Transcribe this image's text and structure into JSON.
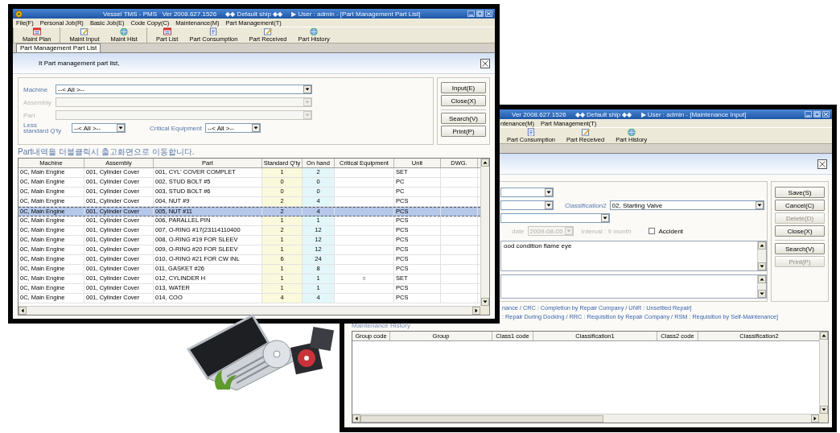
{
  "part_list_window": {
    "title": "Vessel TMS - PMS   Ver 2008.627.1526     ◆◆ Default ship ◆◆     ▶ User : admin - [Part Management Part List]",
    "menu": [
      "File(F)",
      "Personal Job(R)",
      "Basic Job(E)",
      "Code Copy(C)",
      "Maintenance(M)",
      "Part Management(T)"
    ],
    "toolbar": [
      [
        {
          "label": "Maint Plan",
          "kind": "calendar"
        }
      ],
      [
        {
          "label": "Maint Input",
          "kind": "notepad"
        },
        {
          "label": "Maint Hist",
          "kind": "globe"
        }
      ],
      [
        {
          "label": "Part List",
          "kind": "calendar"
        },
        {
          "label": "Part Consumption",
          "kind": "document"
        },
        {
          "label": "Part Received",
          "kind": "notepad"
        },
        {
          "label": "Part History",
          "kind": "globe"
        }
      ]
    ],
    "tab": "Part Management Part List",
    "header": "It Part management part list,",
    "filters": [
      {
        "label": "Machine",
        "value": "--< All >--",
        "disabled": false
      },
      {
        "label": "Assembly",
        "disabled": true
      },
      {
        "label": "Part",
        "disabled": true
      }
    ],
    "less_standard_qty": {
      "label": "Less standard Q'ty",
      "value": "--< All >--"
    },
    "critical_equipment": {
      "label": "Critical Equipment",
      "value": "--< All >--"
    },
    "button_groups": [
      [
        {
          "label": "Input(E)",
          "disabled": false
        },
        {
          "label": "Close(X)",
          "disabled": false
        }
      ],
      [
        {
          "label": "Search(V)",
          "disabled": false
        },
        {
          "label": "Print(P)",
          "disabled": false
        }
      ]
    ],
    "note": "Part내역을 더블클릭시 출고화면으로 이동합니다.",
    "table": {
      "columns": [
        {
          "label": "Machine",
          "kind": "text"
        },
        {
          "label": "Assembly",
          "kind": "text"
        },
        {
          "label": "Part",
          "kind": "text"
        },
        {
          "label": "Standard Q'ty",
          "kind": "number",
          "color": "#fbf9dc"
        },
        {
          "label": "On hand",
          "kind": "number",
          "color": "#e3f7fb"
        },
        {
          "label": "Critical Equipment",
          "kind": "mark"
        },
        {
          "label": "Unit",
          "kind": "text"
        },
        {
          "label": "DWG.",
          "kind": "text"
        }
      ],
      "rows": [
        {
          "machine": "0C, Main Engine",
          "assembly": "001, Cylinder Cover",
          "part": "001, CYL' COVER COMPLET",
          "standard_qty": "1",
          "on_hand": "2",
          "unit": "SET",
          "selected": false
        },
        {
          "machine": "0C, Main Engine",
          "assembly": "001, Cylinder Cover",
          "part": "002, STUD BOLT #5",
          "standard_qty": "0",
          "on_hand": "0",
          "unit": "PC",
          "selected": false
        },
        {
          "machine": "0C, Main Engine",
          "assembly": "001, Cylinder Cover",
          "part": "003, STUD BOLT #6",
          "standard_qty": "0",
          "on_hand": "0",
          "unit": "PC",
          "selected": false
        },
        {
          "machine": "0C, Main Engine",
          "assembly": "001, Cylinder Cover",
          "part": "004, NUT #9",
          "standard_qty": "2",
          "on_hand": "4",
          "unit": "PCS",
          "selected": false
        },
        {
          "machine": "0C, Main Engine",
          "assembly": "001, Cylinder Cover",
          "part": "005, NUT #11",
          "standard_qty": "2",
          "on_hand": "4",
          "unit": "PCS",
          "selected": true
        },
        {
          "machine": "0C, Main Engine",
          "assembly": "001, Cylinder Cover",
          "part": "006, PARALLEL PIN",
          "standard_qty": "1",
          "on_hand": "1",
          "unit": "PCS",
          "selected": false
        },
        {
          "machine": "0C, Main Engine",
          "assembly": "001, Cylinder Cover",
          "part": "007, O-RING #17(23114110400",
          "standard_qty": "2",
          "on_hand": "12",
          "unit": "PCS",
          "selected": false
        },
        {
          "machine": "0C, Main Engine",
          "assembly": "001, Cylinder Cover",
          "part": "008, O-RING #19 FOR SLEEV",
          "standard_qty": "1",
          "on_hand": "12",
          "unit": "PCS",
          "selected": false
        },
        {
          "machine": "0C, Main Engine",
          "assembly": "001, Cylinder Cover",
          "part": "009, O-RING #20 FOR SLEEV",
          "standard_qty": "1",
          "on_hand": "12",
          "unit": "PCS",
          "selected": false
        },
        {
          "machine": "0C, Main Engine",
          "assembly": "001, Cylinder Cover",
          "part": "010, O-RING #21 FOR CW INL",
          "standard_qty": "6",
          "on_hand": "24",
          "unit": "PCS",
          "selected": false
        },
        {
          "machine": "0C, Main Engine",
          "assembly": "001, Cylinder Cover",
          "part": "011, GASKET #26",
          "standard_qty": "1",
          "on_hand": "8",
          "unit": "PCS",
          "selected": false
        },
        {
          "machine": "0C, Main Engine",
          "assembly": "001, Cylinder Cover",
          "part": "012, CYLINDER H",
          "standard_qty": "1",
          "on_hand": "1",
          "critical_equipment": "○",
          "unit": "SET",
          "selected": false
        },
        {
          "machine": "0C, Main Engine",
          "assembly": "001, Cylinder Cover",
          "part": "013, WATER",
          "standard_qty": "1",
          "on_hand": "1",
          "unit": "PCS",
          "selected": false
        },
        {
          "machine": "0C, Main Engine",
          "assembly": "001, Cylinder Cover",
          "part": "014, COO",
          "standard_qty": "4",
          "on_hand": "4",
          "unit": "PCS",
          "selected": false
        }
      ]
    }
  },
  "maintenance_input_window": {
    "title": "Ver 2008.627.1526     ◆◆ Default ship ◆◆     ▶ User : admin - [Maintenance Input]",
    "menu": [
      "ntenance(M)",
      "Part Management(T)"
    ],
    "toolbar": [
      [
        {
          "label": "Part Consumption",
          "kind": "document"
        },
        {
          "label": "Part Received",
          "kind": "notepad"
        },
        {
          "label": "Part History",
          "kind": "globe"
        }
      ]
    ],
    "form_rows": [
      [
        {
          "kind": "dropdown",
          "disabled": false
        }
      ],
      [
        {
          "kind": "dropdown",
          "disabled": false
        },
        {
          "kind": "dropdown",
          "label": "Classification2",
          "value": "02, Starting Valve",
          "disabled": false
        }
      ],
      [
        {
          "kind": "dropdown",
          "disabled": false
        }
      ],
      [
        {
          "kind": "dropdown",
          "label": "date",
          "value": "2009-08-05",
          "disabled": true
        },
        {
          "kind": "note",
          "text": "Interval : 9 month"
        },
        {
          "kind": "checkbox",
          "label": "Accident",
          "checked": false
        }
      ],
      [
        {
          "kind": "textarea",
          "value": "ood condition flame eye"
        }
      ],
      [
        {
          "kind": "textarea"
        }
      ]
    ],
    "button_groups": [
      [
        {
          "label": "Save(S)",
          "disabled": false
        },
        {
          "label": "Cancel(C)",
          "disabled": false
        },
        {
          "label": "Delete(D)",
          "disabled": true
        },
        {
          "label": "Close(X)",
          "disabled": false
        }
      ],
      [
        {
          "label": "Search(V)",
          "disabled": false
        },
        {
          "label": "Print(P)",
          "disabled": true
        }
      ]
    ],
    "legend": [
      "nance / CRC : Completion by Repair Company / UNR : Unsettled Repair]",
      ": Repair During Docking / RRC : Requisition by Repair Company / RSM : Requisition by Self-Maintenance]"
    ],
    "history": {
      "title": "Maintenance History",
      "table": {
        "columns": [
          {
            "label": "Group code"
          },
          {
            "label": "Group"
          },
          {
            "label": "Class1 code"
          },
          {
            "label": "Classification1"
          },
          {
            "label": "Class2 code"
          },
          {
            "label": "Classification2"
          }
        ]
      }
    }
  }
}
